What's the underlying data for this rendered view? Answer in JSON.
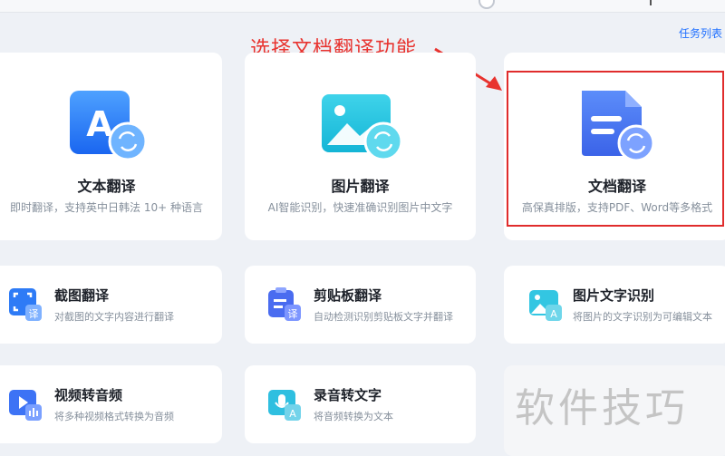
{
  "header": {
    "task_list": "任务列表"
  },
  "annotation": {
    "text": "选择文档翻译功能",
    "color": "#e8332f"
  },
  "main_features": [
    {
      "title": "文本翻译",
      "desc": "即时翻译，支持英中日韩法 10+ 种语言",
      "icon": "text-translate-icon"
    },
    {
      "title": "图片翻译",
      "desc": "AI智能识别，快速准确识别图片中文字",
      "icon": "image-translate-icon"
    },
    {
      "title": "文档翻译",
      "desc": "高保真排版，支持PDF、Word等多格式",
      "icon": "document-translate-icon",
      "highlighted": true
    }
  ],
  "tools": [
    {
      "title": "截图翻译",
      "desc": "对截图的文字内容进行翻译",
      "icon": "screenshot-translate-icon"
    },
    {
      "title": "剪贴板翻译",
      "desc": "自动检测识别剪贴板文字并翻译",
      "icon": "clipboard-translate-icon"
    },
    {
      "title": "图片文字识别",
      "desc": "将图片的文字识别为可编辑文本",
      "icon": "image-ocr-icon"
    },
    {
      "title": "视频转音频",
      "desc": "将多种视频格式转换为音频",
      "icon": "video-to-audio-icon"
    },
    {
      "title": "录音转文字",
      "desc": "将音频转换为文本",
      "icon": "audio-to-text-icon"
    }
  ],
  "watermark": "软件技巧",
  "colors": {
    "accent": "#1e6fff",
    "highlight_border": "#e02c2c",
    "background": "#eef1f6"
  }
}
